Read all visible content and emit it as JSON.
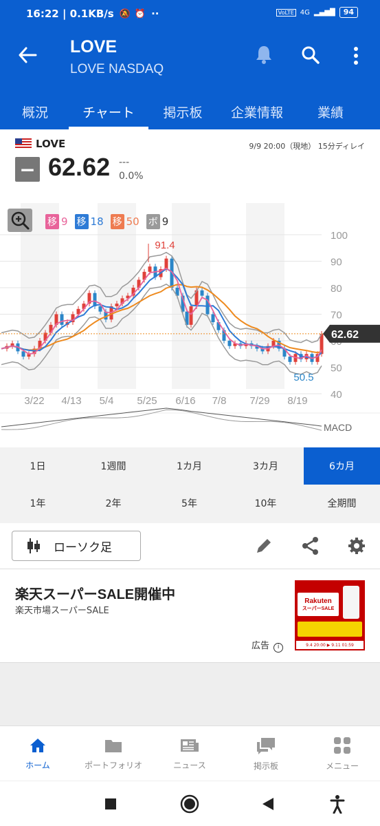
{
  "status_bar": {
    "time": "16:22 | 0.1KB/s",
    "network": "4G",
    "battery": "94"
  },
  "header": {
    "title": "LOVE",
    "subtitle": "LOVE NASDAQ",
    "tabs": [
      {
        "label": "概況"
      },
      {
        "label": "チャート"
      },
      {
        "label": "掲示板"
      },
      {
        "label": "企業情報"
      },
      {
        "label": "業績"
      }
    ]
  },
  "quote": {
    "ticker": "LOVE",
    "timestamp": "9/9 20:00（現地） 15分ディレイ",
    "price": "62.62",
    "change": "---",
    "change_pct": "0.0%"
  },
  "chart": {
    "legend": [
      {
        "chip": "移",
        "value": "9",
        "color": "#e8639a"
      },
      {
        "chip": "移",
        "value": "18",
        "color": "#2e7bd6"
      },
      {
        "chip": "移",
        "value": "50",
        "color": "#ee7b50"
      },
      {
        "chip": "ボ",
        "value": "9",
        "color": "#9a9a9a"
      }
    ],
    "y_ticks": [
      "100",
      "90",
      "80",
      "70",
      "60",
      "50",
      "40"
    ],
    "x_ticks": [
      "3/22",
      "4/13",
      "5/4",
      "5/25",
      "6/16",
      "7/8",
      "7/29",
      "8/19"
    ],
    "high_label": "91.4",
    "low_label": "50.5",
    "current_label": "62.62",
    "macd_label": "MACD"
  },
  "periods": {
    "row1": [
      "1日",
      "1週間",
      "1カ月",
      "3カ月",
      "6カ月"
    ],
    "row2": [
      "1年",
      "2年",
      "5年",
      "10年",
      "全期間"
    ],
    "active": "6カ月"
  },
  "toolbar": {
    "chart_type": "ローソク足"
  },
  "ad": {
    "title": "楽天スーパーSALE開催中",
    "subtitle": "楽天市場スーパーSALE",
    "label": "広告",
    "image_lines": [
      "Rakuten",
      "スーパーSALE",
      "9.4 20:00 ▶ 9.11 01:59"
    ]
  },
  "bottom_nav": [
    {
      "label": "ホーム",
      "icon": "home-icon"
    },
    {
      "label": "ポートフォリオ",
      "icon": "folder-icon"
    },
    {
      "label": "ニュース",
      "icon": "news-icon"
    },
    {
      "label": "掲示板",
      "icon": "chat-icon"
    },
    {
      "label": "メニュー",
      "icon": "grid-icon"
    }
  ]
}
